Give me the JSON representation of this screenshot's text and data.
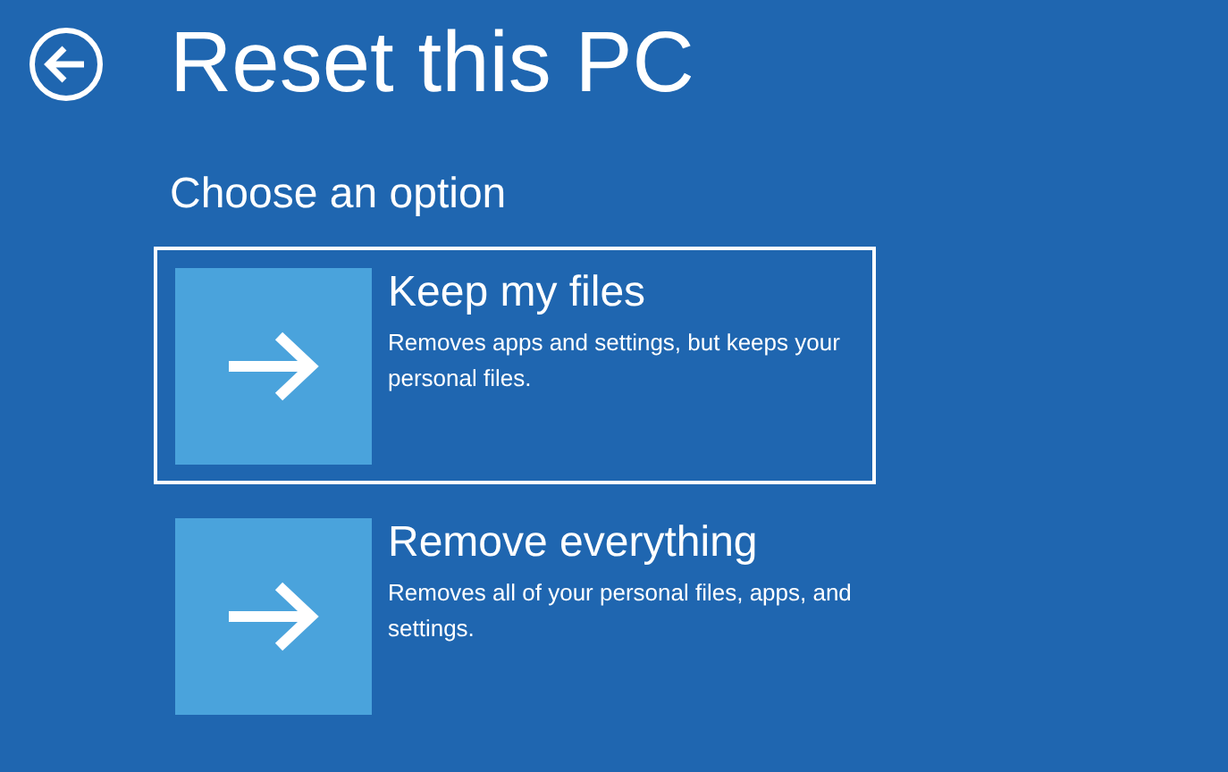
{
  "header": {
    "title": "Reset this PC"
  },
  "subtitle": "Choose an option",
  "options": [
    {
      "title": "Keep my files",
      "description": "Removes apps and settings, but keeps your personal files.",
      "selected": true
    },
    {
      "title": "Remove everything",
      "description": "Removes all of your personal files, apps, and settings.",
      "selected": false
    }
  ]
}
